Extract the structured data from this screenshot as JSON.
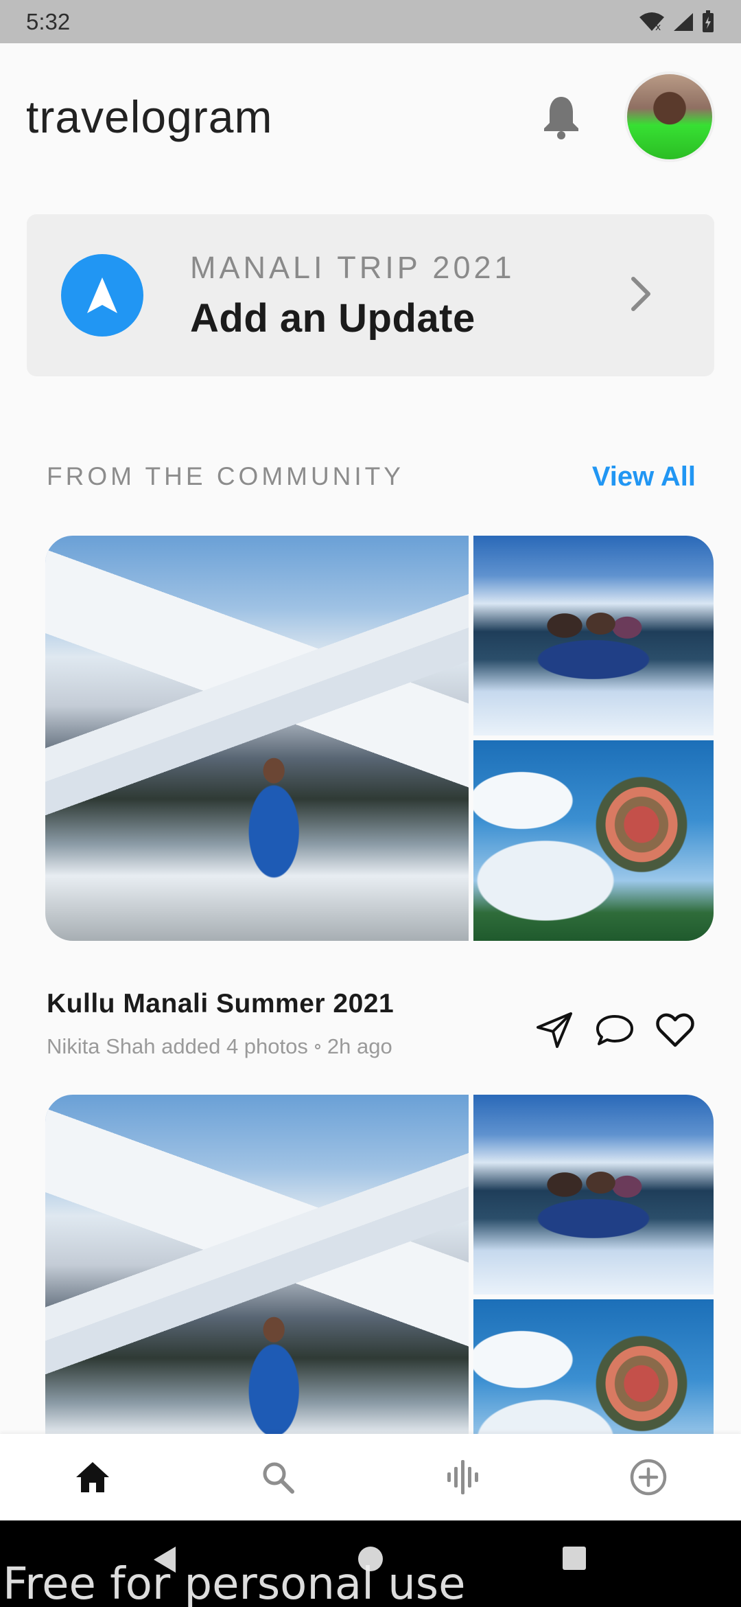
{
  "status_bar": {
    "time": "5:32"
  },
  "header": {
    "app_title": "travelogram",
    "notification_icon": "bell-icon",
    "avatar": "profile-avatar"
  },
  "update_card": {
    "trip_name": "MANALI TRIP 2021",
    "cta": "Add an Update",
    "icon": "navigation-arrow-icon",
    "chevron": "chevron-right-icon",
    "accent": "#2196F3"
  },
  "community": {
    "title": "FROM THE COMMUNITY",
    "view_all": "View All"
  },
  "posts": [
    {
      "title": "Kullu Manali Summer 2021",
      "author_line": "Nikita Shah added 4 photos",
      "time_ago": "2h ago",
      "photos": [
        "woman-in-snow-mountains",
        "group-lying-in-snow",
        "hot-air-balloon"
      ]
    },
    {
      "photos": [
        "woman-in-snow-mountains",
        "group-lying-in-snow",
        "hot-air-balloon"
      ]
    }
  ],
  "bottom_nav": [
    "home-icon",
    "search-icon",
    "audio-wave-icon",
    "add-circle-icon"
  ],
  "watermark": "Free for personal use"
}
